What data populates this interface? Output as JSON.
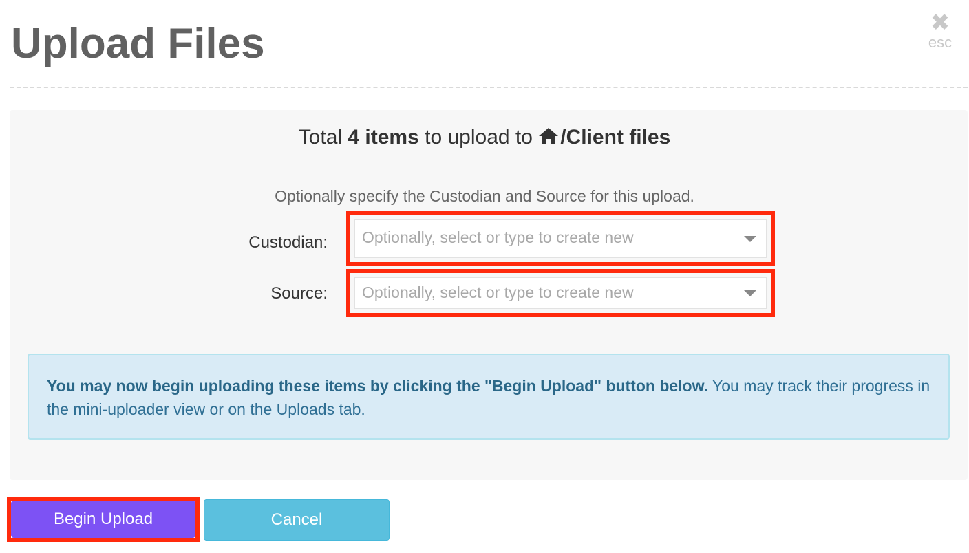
{
  "dialog": {
    "title": "Upload Files",
    "close": {
      "icon": "close-icon",
      "esc_label": "esc"
    }
  },
  "summary": {
    "prefix": "Total",
    "count_text": "4 items",
    "middle": "to upload to",
    "home_icon": "home-icon",
    "destination": "/Client files"
  },
  "hint": "Optionally specify the Custodian and Source for this upload.",
  "fields": {
    "custodian": {
      "label": "Custodian:",
      "placeholder": "Optionally, select or type to create new"
    },
    "source": {
      "label": "Source:",
      "placeholder": "Optionally, select or type to create new"
    }
  },
  "info": {
    "bold": "You may now begin uploading these items by clicking the \"Begin Upload\" button below.",
    "rest": " You may track their progress in the mini-uploader view or on the Uploads tab."
  },
  "buttons": {
    "begin": "Begin Upload",
    "cancel": "Cancel"
  },
  "colors": {
    "highlight": "#ff2a0d",
    "primary": "#7d52f4",
    "cancel": "#5bc0de",
    "info_bg": "#d9ebf6"
  }
}
